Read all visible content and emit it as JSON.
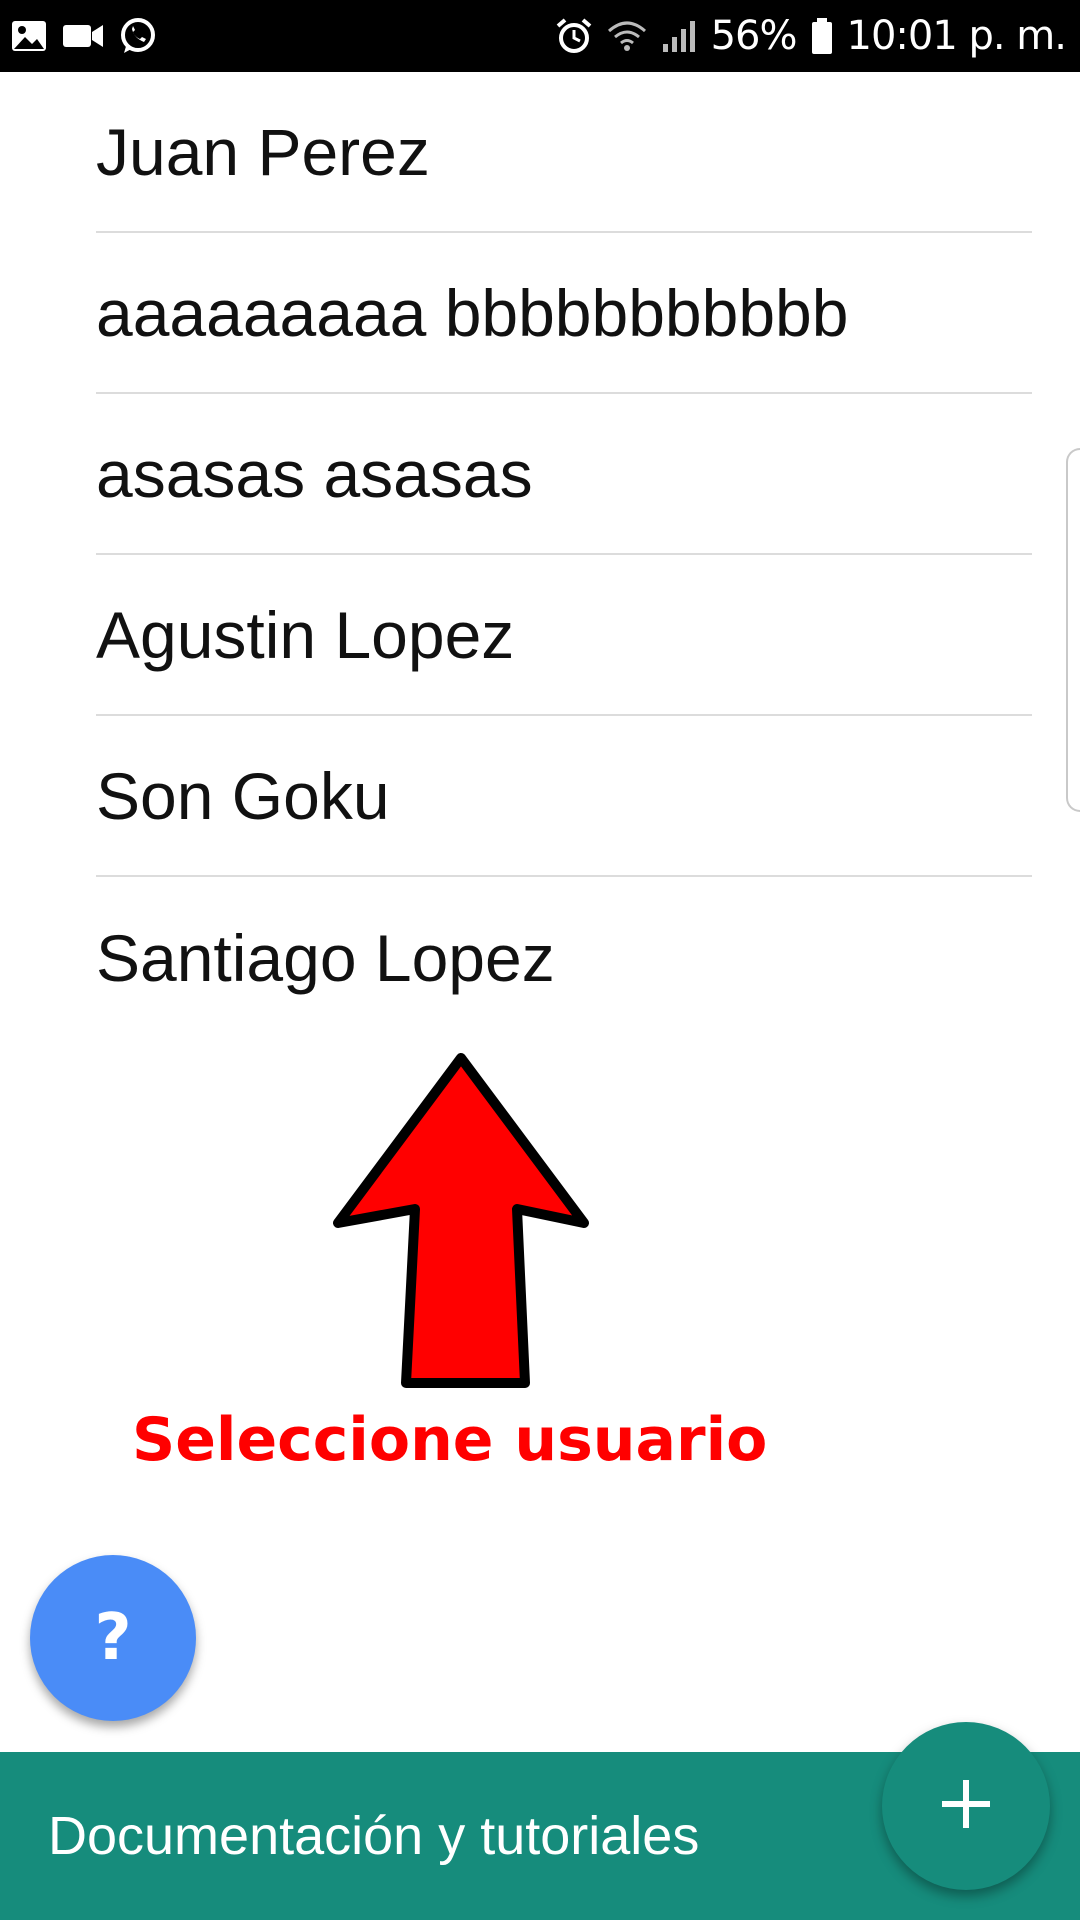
{
  "status_bar": {
    "battery": "56%",
    "time": "10:01 p. m.",
    "left_icons": [
      "image-icon",
      "video-camera-icon",
      "whatsapp-icon"
    ],
    "right_icons": [
      "alarm-icon",
      "wifi-icon",
      "signal-icon",
      "battery-icon"
    ]
  },
  "users": [
    {
      "name": "Juan Perez"
    },
    {
      "name": "aaaaaaaaa bbbbbbbbbbb"
    },
    {
      "name": "asasas asasas"
    },
    {
      "name": "Agustin Lopez"
    },
    {
      "name": "Son Goku"
    },
    {
      "name": "Santiago Lopez"
    }
  ],
  "annotation": {
    "label": "Seleccione usuario",
    "color": "#ff0000",
    "icon": "up-arrow-icon"
  },
  "help_button": {
    "label": "?",
    "color": "#4a8cf7"
  },
  "bottom_bar": {
    "label": "Documentación y tutoriales",
    "color": "#168c7c"
  },
  "add_button": {
    "icon": "plus-icon"
  }
}
